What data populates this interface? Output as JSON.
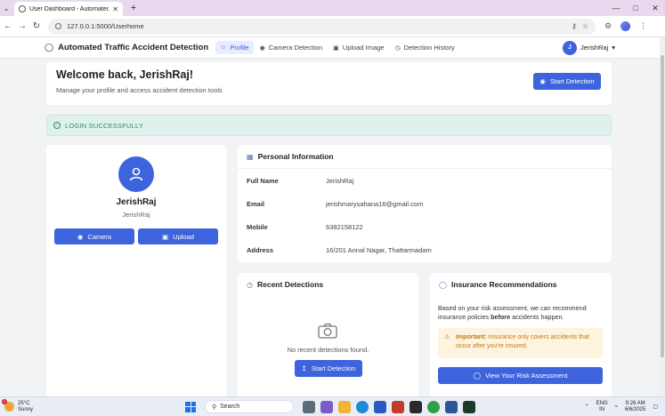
{
  "browser": {
    "tab_title": "User Dashboard - Automated T",
    "url": "127.0.0.1:5000/Userhome"
  },
  "navbar": {
    "brand": "Automated Traffic Accident Detection",
    "links": [
      {
        "label": "Profile",
        "active": true
      },
      {
        "label": "Camera Detection",
        "active": false
      },
      {
        "label": "Upload Image",
        "active": false
      },
      {
        "label": "Detection History",
        "active": false
      }
    ],
    "user_initial": "J",
    "user_name": "JerishRaj"
  },
  "welcome": {
    "title": "Welcome back, JerishRaj!",
    "subtitle": "Manage your profile and access accident detection tools",
    "start_button": "Start Detection"
  },
  "alert": {
    "text": "LOGIN SUCCESSFULLY"
  },
  "profile": {
    "name": "JerishRaj",
    "username": "JerishRaj",
    "camera_button": "Camera",
    "upload_button": "Upload"
  },
  "personal_info": {
    "title": "Personal Information",
    "rows": [
      {
        "label": "Full Name",
        "value": "JerishRaj"
      },
      {
        "label": "Email",
        "value": "jerishmarysahana16@gmail.com"
      },
      {
        "label": "Mobile",
        "value": "6382158122"
      },
      {
        "label": "Address",
        "value": "16/201 Annal Nagar, Thattarmadam"
      }
    ]
  },
  "recent": {
    "title": "Recent Detections",
    "empty_text": "No recent detections found.",
    "button": "Start Detection"
  },
  "insurance": {
    "title": "Insurance Recommendations",
    "text_before": "Based on your risk assessment, we can recommend insurance policies ",
    "text_bold": "before",
    "text_after": " accidents happen.",
    "warn_label": "Important:",
    "warn_text": " Insurance only covers accidents that occur after you're insured.",
    "button": "View Your Risk Assessment"
  },
  "taskbar": {
    "temp": "25°C",
    "condition": "Sunny",
    "search": "Search",
    "lang1": "ENG",
    "lang2": "IN",
    "time": "9:26 AM",
    "date": "6/6/2025"
  },
  "colors": {
    "primary": "#3d63dd",
    "success_bg": "#dff1ec",
    "success_text": "#2c8a6b",
    "warning_bg": "#fdf3de",
    "warning_text": "#c07b17"
  }
}
